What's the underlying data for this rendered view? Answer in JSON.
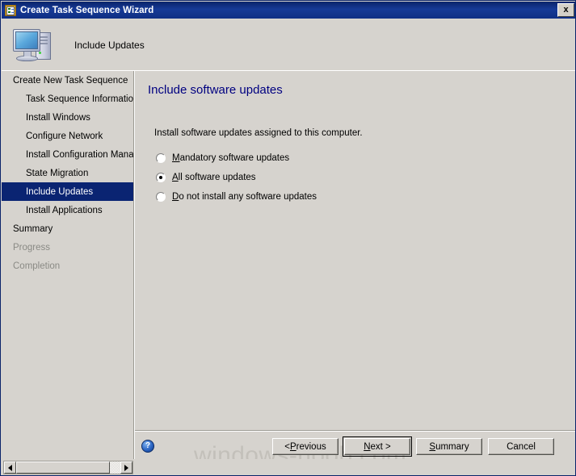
{
  "window": {
    "title": "Create Task Sequence Wizard",
    "title_icon": "checklist-icon",
    "close_label": "x"
  },
  "header": {
    "title": "Include Updates",
    "icon": "computer-icon"
  },
  "sidebar": {
    "items": [
      {
        "label": "Create New Task Sequence",
        "level": 0,
        "state": "normal"
      },
      {
        "label": "Task Sequence Information",
        "level": 1,
        "state": "normal"
      },
      {
        "label": "Install Windows",
        "level": 1,
        "state": "normal"
      },
      {
        "label": "Configure Network",
        "level": 1,
        "state": "normal"
      },
      {
        "label": "Install Configuration Manag",
        "level": 1,
        "state": "normal"
      },
      {
        "label": "State Migration",
        "level": 1,
        "state": "normal"
      },
      {
        "label": "Include Updates",
        "level": 1,
        "state": "selected"
      },
      {
        "label": "Install Applications",
        "level": 1,
        "state": "normal"
      },
      {
        "label": "Summary",
        "level": 0,
        "state": "normal"
      },
      {
        "label": "Progress",
        "level": 0,
        "state": "disabled"
      },
      {
        "label": "Completion",
        "level": 0,
        "state": "disabled"
      }
    ]
  },
  "content": {
    "heading": "Include software updates",
    "description": "Install software updates assigned to this computer.",
    "options": [
      {
        "label_accel": "M",
        "label_rest": "andatory software updates",
        "checked": false
      },
      {
        "label_accel": "A",
        "label_rest": "ll software updates",
        "checked": true
      },
      {
        "label_accel": "D",
        "label_rest": "o not install any software updates",
        "checked": false
      }
    ]
  },
  "footer": {
    "help_icon": "help-question-icon",
    "watermark": "windows-noob.com",
    "buttons": [
      {
        "pre": "< ",
        "accel": "P",
        "rest": "revious",
        "default": false
      },
      {
        "pre": "",
        "accel": "N",
        "rest": "ext >",
        "default": true
      },
      {
        "pre": "",
        "accel": "S",
        "rest": "ummary",
        "default": false
      },
      {
        "pre": "",
        "accel": "",
        "rest": "Cancel",
        "default": false
      }
    ]
  },
  "scrollbar": {
    "left_arrow": "arrow-left-icon",
    "right_arrow": "arrow-right-icon"
  },
  "colors": {
    "titlebar": "#163a96",
    "selection": "#0a2472",
    "heading": "#000080",
    "face": "#d6d3ce"
  }
}
